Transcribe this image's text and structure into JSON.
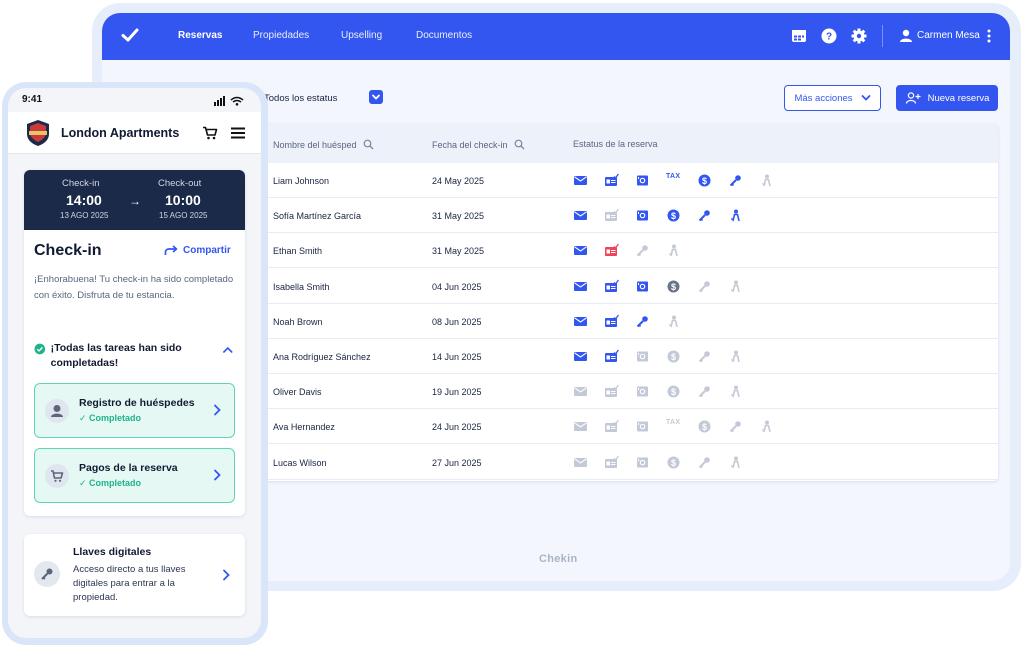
{
  "desktop": {
    "nav": [
      "Reservas",
      "Propiedades",
      "Upselling",
      "Documentos"
    ],
    "user_name": "Carmen Mesa",
    "filter_label": "Todos los estatus",
    "more_actions": "Más acciones",
    "new_booking": "Nueva reserva",
    "table": {
      "headers": [
        "Nombre del huésped",
        "Fecha del check-in",
        "Estatus de la reserva"
      ],
      "rows": [
        {
          "name": "Liam Johnson",
          "date": "24 May 2025",
          "icons": [
            [
              "mail",
              "a"
            ],
            [
              "id",
              "a"
            ],
            [
              "safe",
              "a"
            ],
            [
              "tax",
              "a"
            ],
            [
              "dollar",
              "a"
            ],
            [
              "key",
              "a"
            ],
            [
              "person",
              "g"
            ]
          ]
        },
        {
          "name": "Sofía Martínez García",
          "date": "31 May 2025",
          "icons": [
            [
              "mail",
              "a"
            ],
            [
              "id",
              "g"
            ],
            [
              "safe",
              "a"
            ],
            [
              "dollar",
              "a"
            ],
            [
              "key",
              "a"
            ],
            [
              "person",
              "a"
            ]
          ]
        },
        {
          "name": "Ethan Smith",
          "date": "31 May 2025",
          "icons": [
            [
              "mail",
              "a"
            ],
            [
              "id",
              "r"
            ],
            [
              "key",
              "g"
            ],
            [
              "person",
              "g"
            ]
          ]
        },
        {
          "name": "Isabella Smith",
          "date": "04 Jun 2025",
          "icons": [
            [
              "mail",
              "a"
            ],
            [
              "id",
              "a"
            ],
            [
              "safe",
              "a"
            ],
            [
              "dollar",
              "d"
            ],
            [
              "key",
              "g"
            ],
            [
              "person",
              "g"
            ]
          ]
        },
        {
          "name": "Noah Brown",
          "date": "08 Jun 2025",
          "icons": [
            [
              "mail",
              "a"
            ],
            [
              "id",
              "a"
            ],
            [
              "key",
              "a"
            ],
            [
              "person",
              "g"
            ]
          ]
        },
        {
          "name": "Ana Rodríguez Sánchez",
          "date": "14 Jun 2025",
          "icons": [
            [
              "mail",
              "a"
            ],
            [
              "id",
              "a"
            ],
            [
              "safe",
              "g"
            ],
            [
              "dollar",
              "g"
            ],
            [
              "key",
              "g"
            ],
            [
              "person",
              "g"
            ]
          ]
        },
        {
          "name": "Oliver Davis",
          "date": "19 Jun 2025",
          "icons": [
            [
              "mail",
              "g"
            ],
            [
              "id",
              "g"
            ],
            [
              "safe",
              "g"
            ],
            [
              "dollar",
              "g"
            ],
            [
              "key",
              "g"
            ],
            [
              "person",
              "g"
            ]
          ]
        },
        {
          "name": "Ava Hernandez",
          "date": "24 Jun 2025",
          "icons": [
            [
              "mail",
              "g"
            ],
            [
              "id",
              "g"
            ],
            [
              "safe",
              "g"
            ],
            [
              "tax",
              "g"
            ],
            [
              "dollar",
              "g"
            ],
            [
              "key",
              "g"
            ],
            [
              "person",
              "g"
            ]
          ]
        },
        {
          "name": "Lucas Wilson",
          "date": "27 Jun 2025",
          "icons": [
            [
              "mail",
              "g"
            ],
            [
              "id",
              "g"
            ],
            [
              "safe",
              "g"
            ],
            [
              "dollar",
              "g"
            ],
            [
              "key",
              "g"
            ],
            [
              "person",
              "g"
            ]
          ]
        }
      ]
    },
    "footer_brand": "Chekin",
    "colors": {
      "primary": "#3456f0",
      "active_icon": "#3456f0",
      "inactive_icon": "#c3c9d6",
      "error_icon": "#f0445a"
    }
  },
  "phone": {
    "time": "9:41",
    "property": "London Apartments",
    "checkin_label": "Check-in",
    "checkin_time": "14:00",
    "checkin_date": "13 AGO 2025",
    "checkout_label": "Check-out",
    "checkout_time": "10:00",
    "checkout_date": "15 AGO 2025",
    "title": "Check-in",
    "share": "Compartir",
    "message": "¡Enhorabuena! Tu check-in ha sido completado con éxito. Disfruta de tu estancia.",
    "tasks_done": "¡Todas las tareas han sido completadas!",
    "tasks": [
      {
        "title": "Registro de huéspedes",
        "status": "Completado",
        "icon": "person-icon"
      },
      {
        "title": "Pagos de la reserva",
        "status": "Completado",
        "icon": "cart-icon"
      }
    ],
    "keys_title": "Llaves digitales",
    "keys_text": "Acceso directo a tus llaves digitales para entrar a la propiedad."
  }
}
